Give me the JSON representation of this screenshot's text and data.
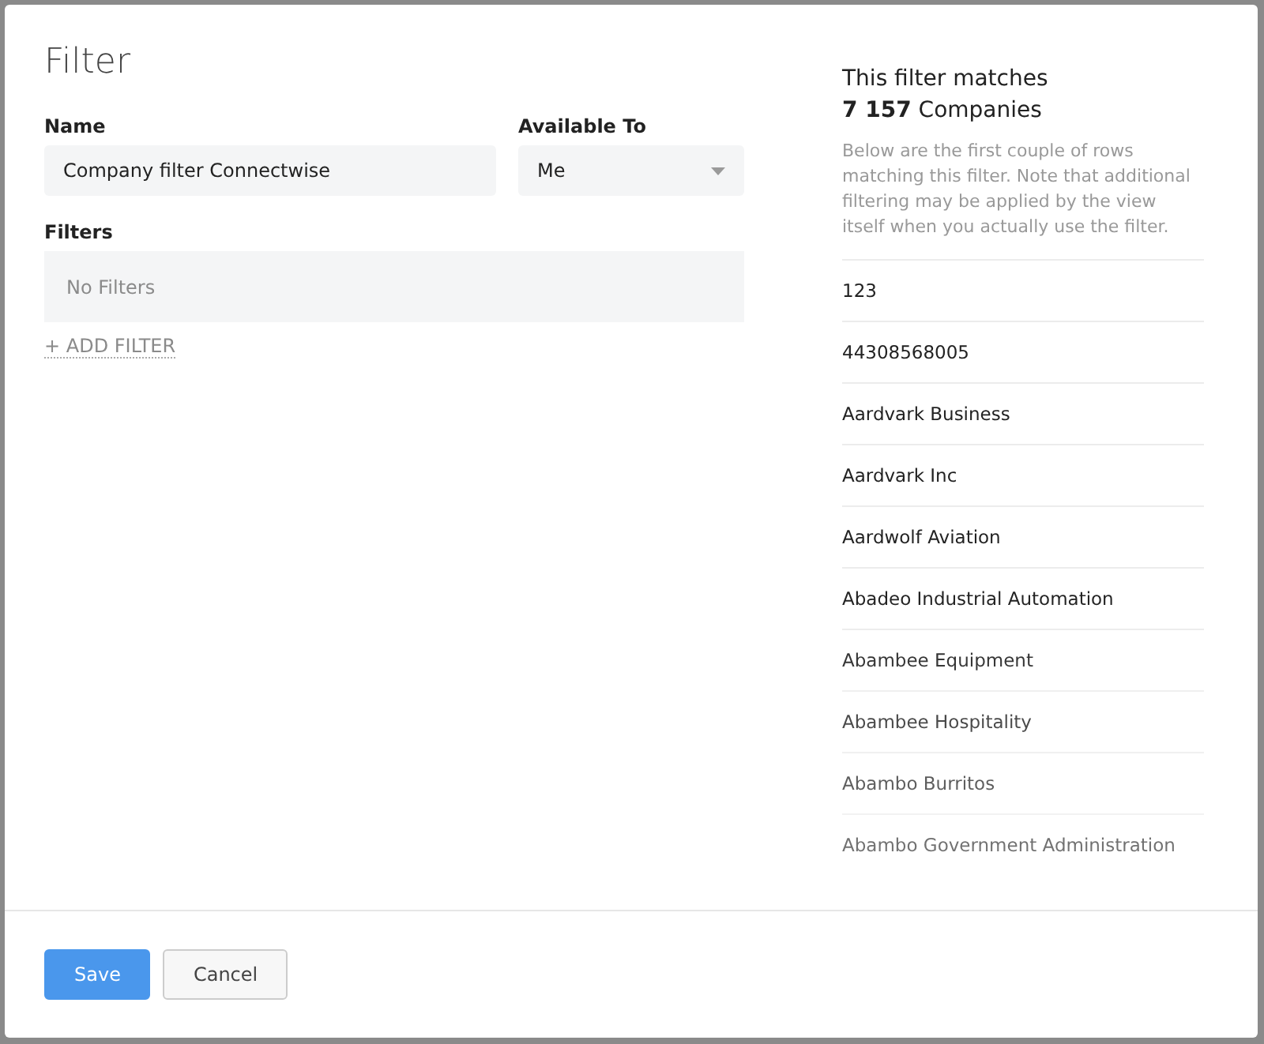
{
  "dialog": {
    "title": "Filter"
  },
  "name_field": {
    "label": "Name",
    "value": "Company filter Connectwise"
  },
  "available_to": {
    "label": "Available To",
    "value": "Me"
  },
  "filters": {
    "label": "Filters",
    "empty_text": "No Filters",
    "add_link": "+ ADD FILTER"
  },
  "preview": {
    "heading": "This filter matches",
    "count": "**7 157** Companies",
    "note": "Below are the first couple of rows matching this filter. Note that additional filtering may be applied by the view itself when you actually use the filter.",
    "rows": [
      "123",
      "44308568005",
      "Aardvark Business",
      "Aardvark Inc",
      "Aardwolf Aviation",
      "Abadeo Industrial Automation",
      "Abambee Equipment",
      "Abambee Hospitality",
      "Abambo Burritos",
      "Abambo Government Administration"
    ]
  },
  "buttons": [
    {
      "label": "Save",
      "kind": "primary"
    },
    {
      "label": "Cancel",
      "kind": "secondary"
    }
  ]
}
